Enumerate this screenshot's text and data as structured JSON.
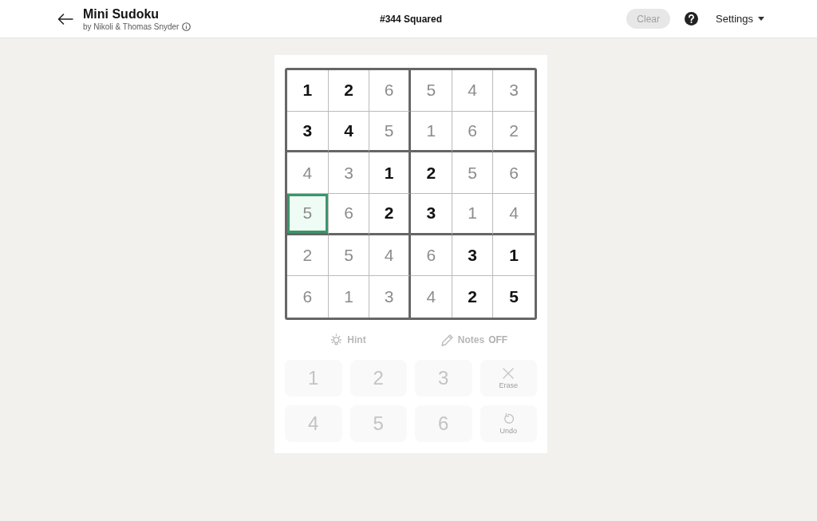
{
  "header": {
    "title": "Mini Sudoku",
    "byline": "by Nikoli & Thomas Snyder",
    "puzzle_title": "#344 Squared",
    "clear_button": {
      "label": "Clear",
      "disabled": true
    },
    "settings": {
      "label": "Settings"
    }
  },
  "grid": {
    "rows": [
      [
        {
          "value": "1",
          "given": true,
          "selected": false
        },
        {
          "value": "2",
          "given": true,
          "selected": false
        },
        {
          "value": "6",
          "given": false,
          "selected": false
        },
        {
          "value": "5",
          "given": false,
          "selected": false
        },
        {
          "value": "4",
          "given": false,
          "selected": false
        },
        {
          "value": "3",
          "given": false,
          "selected": false
        }
      ],
      [
        {
          "value": "3",
          "given": true,
          "selected": false
        },
        {
          "value": "4",
          "given": true,
          "selected": false
        },
        {
          "value": "5",
          "given": false,
          "selected": false
        },
        {
          "value": "1",
          "given": false,
          "selected": false
        },
        {
          "value": "6",
          "given": false,
          "selected": false
        },
        {
          "value": "2",
          "given": false,
          "selected": false
        }
      ],
      [
        {
          "value": "4",
          "given": false,
          "selected": false
        },
        {
          "value": "3",
          "given": false,
          "selected": false
        },
        {
          "value": "1",
          "given": true,
          "selected": false
        },
        {
          "value": "2",
          "given": true,
          "selected": false
        },
        {
          "value": "5",
          "given": false,
          "selected": false
        },
        {
          "value": "6",
          "given": false,
          "selected": false
        }
      ],
      [
        {
          "value": "5",
          "given": false,
          "selected": true
        },
        {
          "value": "6",
          "given": false,
          "selected": false
        },
        {
          "value": "2",
          "given": true,
          "selected": false
        },
        {
          "value": "3",
          "given": true,
          "selected": false
        },
        {
          "value": "1",
          "given": false,
          "selected": false
        },
        {
          "value": "4",
          "given": false,
          "selected": false
        }
      ],
      [
        {
          "value": "2",
          "given": false,
          "selected": false
        },
        {
          "value": "5",
          "given": false,
          "selected": false
        },
        {
          "value": "4",
          "given": false,
          "selected": false
        },
        {
          "value": "6",
          "given": false,
          "selected": false
        },
        {
          "value": "3",
          "given": true,
          "selected": false
        },
        {
          "value": "1",
          "given": true,
          "selected": false
        }
      ],
      [
        {
          "value": "6",
          "given": false,
          "selected": false
        },
        {
          "value": "1",
          "given": false,
          "selected": false
        },
        {
          "value": "3",
          "given": false,
          "selected": false
        },
        {
          "value": "4",
          "given": false,
          "selected": false
        },
        {
          "value": "2",
          "given": true,
          "selected": false
        },
        {
          "value": "5",
          "given": true,
          "selected": false
        }
      ]
    ]
  },
  "tools": [
    {
      "kind": "hint",
      "label": "Hint",
      "disabled": true
    },
    {
      "kind": "notes",
      "label": "Notes",
      "status": "OFF",
      "disabled": true
    }
  ],
  "keypad": [
    {
      "kind": "digit",
      "label": "1",
      "disabled": true
    },
    {
      "kind": "digit",
      "label": "2",
      "disabled": true
    },
    {
      "kind": "digit",
      "label": "3",
      "disabled": true
    },
    {
      "kind": "erase",
      "label": "Erase",
      "disabled": true
    },
    {
      "kind": "digit",
      "label": "4",
      "disabled": true
    },
    {
      "kind": "digit",
      "label": "5",
      "disabled": true
    },
    {
      "kind": "digit",
      "label": "6",
      "disabled": true
    },
    {
      "kind": "undo",
      "label": "Undo",
      "disabled": true
    }
  ]
}
